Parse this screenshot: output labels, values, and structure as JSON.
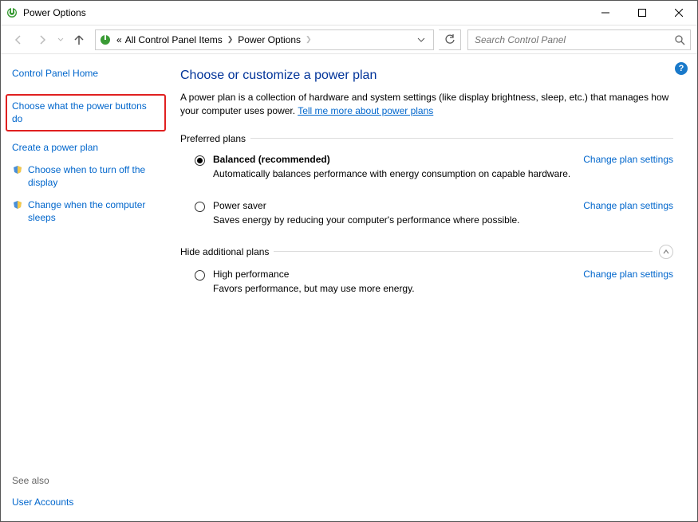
{
  "window": {
    "title": "Power Options"
  },
  "nav": {
    "crumb_prefix": "«",
    "crumb1": "All Control Panel Items",
    "crumb2": "Power Options",
    "search_placeholder": "Search Control Panel"
  },
  "sidebar": {
    "home": "Control Panel Home",
    "links": [
      "Choose what the power buttons do",
      "Create a power plan",
      "Choose when to turn off the display",
      "Change when the computer sleeps"
    ],
    "see_also_label": "See also",
    "see_also_link": "User Accounts"
  },
  "main": {
    "heading": "Choose or customize a power plan",
    "description_pre": "A power plan is a collection of hardware and system settings (like display brightness, sleep, etc.) that manages how your computer uses power. ",
    "description_link": "Tell me more about power plans",
    "preferred_label": "Preferred plans",
    "hide_label": "Hide additional plans",
    "change_link": "Change plan settings",
    "plans": {
      "balanced": {
        "title": "Balanced (recommended)",
        "desc": "Automatically balances performance with energy consumption on capable hardware."
      },
      "saver": {
        "title": "Power saver",
        "desc": "Saves energy by reducing your computer's performance where possible."
      },
      "high": {
        "title": "High performance",
        "desc": "Favors performance, but may use more energy."
      }
    }
  },
  "help": {
    "symbol": "?"
  }
}
